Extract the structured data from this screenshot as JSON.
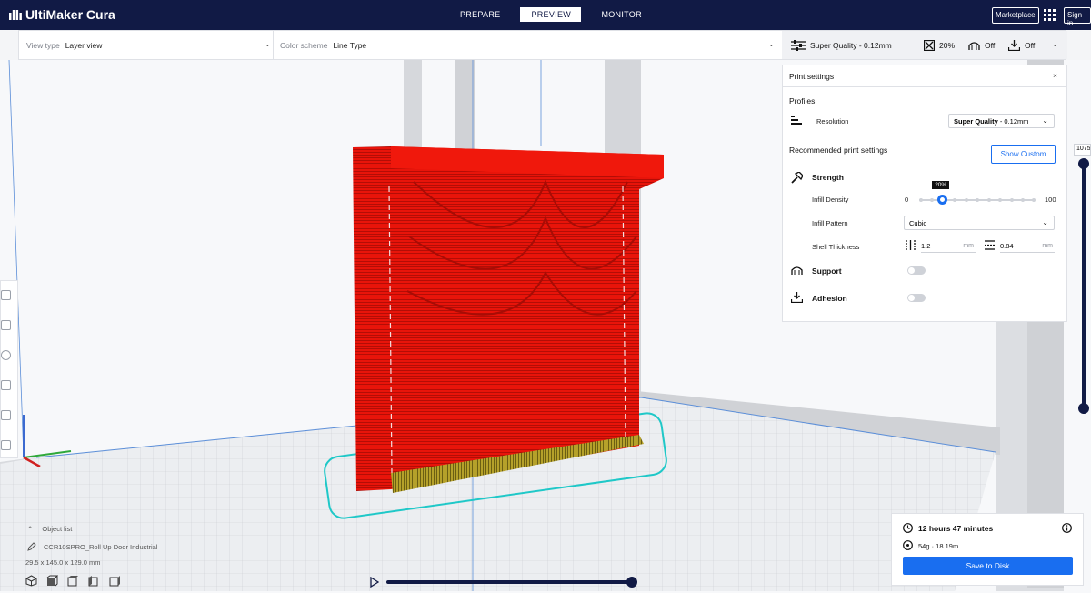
{
  "topbar": {
    "app_name": "UltiMaker Cura",
    "stages": [
      "PREPARE",
      "PREVIEW",
      "MONITOR"
    ],
    "active_stage": "PREVIEW",
    "marketplace_label": "Marketplace",
    "signin_label": "Sign in"
  },
  "subbar": {
    "view_type_label": "View type",
    "view_type_value": "Layer view",
    "color_scheme_label": "Color scheme",
    "color_scheme_value": "Line Type",
    "quality_label": "Super Quality - 0.12mm",
    "infill_value": "20%",
    "support_value": "Off",
    "adhesion_value": "Off"
  },
  "print_settings": {
    "title": "Print settings",
    "profiles_label": "Profiles",
    "resolution_label": "Resolution",
    "resolution_value_bold": "Super Quality",
    "resolution_value_rest": " - 0.12mm",
    "recommended_label": "Recommended print settings",
    "show_custom_label": "Show Custom",
    "strength_label": "Strength",
    "infill_density_label": "Infill Density",
    "infill_min": "0",
    "infill_max": "100",
    "infill_tooltip": "20%",
    "infill_fraction": 0.2,
    "infill_pattern_label": "Infill Pattern",
    "infill_pattern_value": "Cubic",
    "shell_thickness_label": "Shell Thickness",
    "wall_value": "1.2",
    "top_bottom_value": "0.84",
    "unit": "mm",
    "support_label": "Support",
    "support_on": false,
    "adhesion_label": "Adhesion",
    "adhesion_on": false
  },
  "layer_slider": {
    "current_layer": "1075"
  },
  "object": {
    "list_label": "Object list",
    "name": "CCR10SPRO_Roll Up Door Industrial",
    "dimensions": "29.5 x 145.0 x 129.0 mm"
  },
  "estimate": {
    "time": "12 hours 47 minutes",
    "material": "54g · 18.19m",
    "save_label": "Save to Disk"
  },
  "colors": {
    "nav": "#111a45",
    "accent": "#196ef0",
    "model": "#e8140a",
    "skirt": "#1fc8c8"
  }
}
